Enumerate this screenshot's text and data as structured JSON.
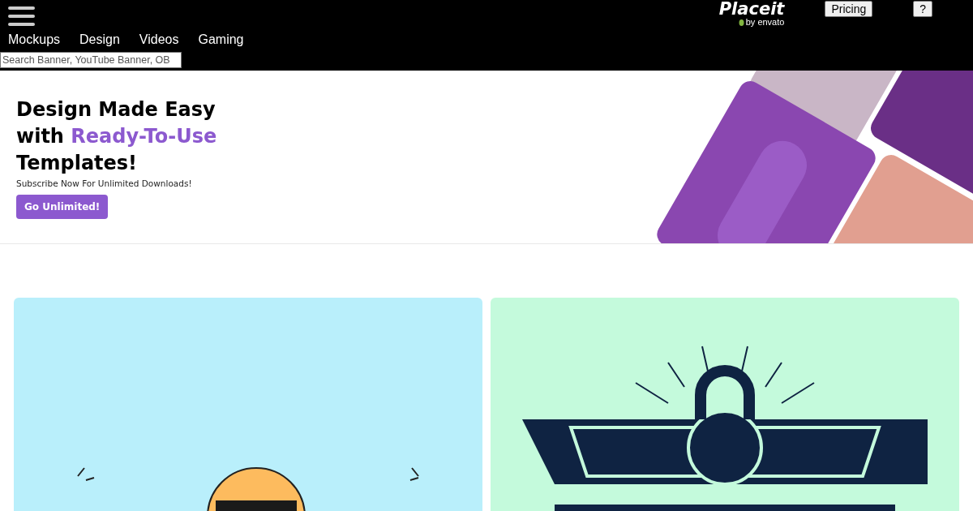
{
  "header": {
    "logo": {
      "name": "Placeit",
      "byline": "by envato"
    },
    "nav": [
      {
        "label": "Mockups"
      },
      {
        "label": "Design"
      },
      {
        "label": "Videos"
      },
      {
        "label": "Gaming"
      }
    ],
    "search": {
      "placeholder": "Search Banner, YouTube Banner, OB"
    },
    "buttons": [
      {
        "label": "Pricing"
      },
      {
        "label": "?"
      }
    ]
  },
  "hero": {
    "title": {
      "before": "Design Made Easy with",
      "highlight": "Ready-To-Use",
      "after": "Templates!"
    },
    "subtitle": "Subscribe Now For Unlimited Downloads!",
    "cta": "Go Unlimited!"
  },
  "cards": [
    {
      "kind": "sunglasses",
      "color": "#b9effb"
    },
    {
      "kind": "kettlebell",
      "color": "#c4fadc"
    }
  ]
}
